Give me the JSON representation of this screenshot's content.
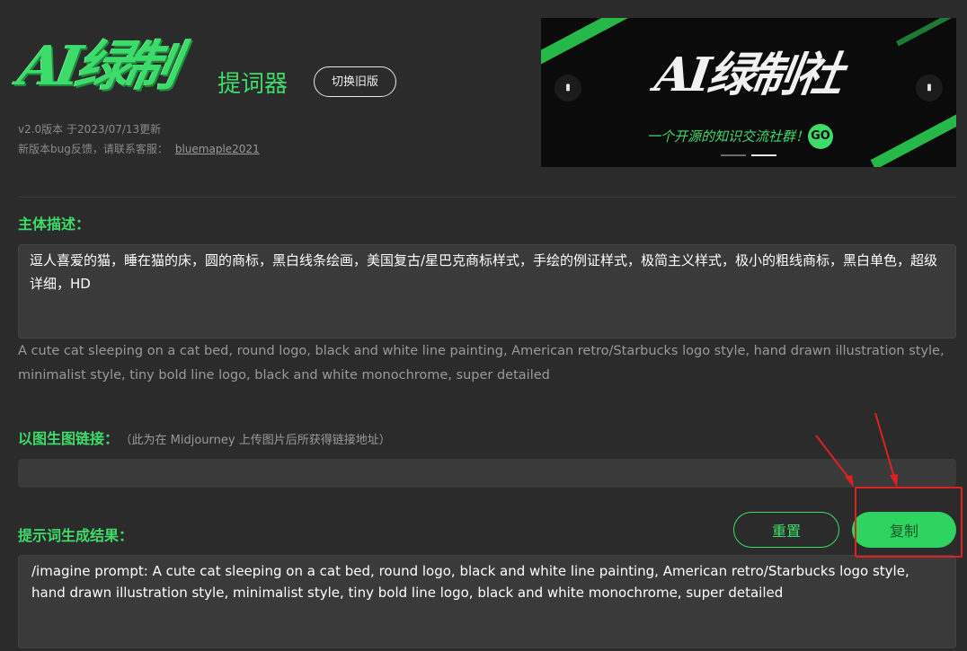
{
  "header": {
    "logo_text": "AI绿制",
    "logo_subtitle": "提词器",
    "switch_label": "切换旧版",
    "version": "v2.0版本 于2023/07/13更新",
    "feedback_text": "新版本bug反馈，请联系客服：",
    "feedback_contact": "bluemaple2021"
  },
  "banner": {
    "title": "AI绿制社",
    "slogan": "一个开源的知识交流社群！",
    "go": "GO",
    "prev_icon": "chevron-left-icon",
    "next_icon": "chevron-right-icon",
    "active_slide": 2,
    "slide_count": 2
  },
  "subject": {
    "title": "主体描述：",
    "text": "逗人喜爱的猫，睡在猫的床，圆的商标，黑白线条绘画，美国复古/星巴克商标样式，手绘的例证样式，极简主义样式，极小的粗线商标，黑白单色，超级详细，HD",
    "translation": "A cute cat sleeping on a cat bed, round logo, black and white line painting, American retro/Starbucks logo style, hand drawn illustration style, minimalist style, tiny bold line logo, black and white monochrome, super detailed"
  },
  "image_link": {
    "title": "以图生图链接：",
    "hint": "（此为在 Midjourney 上传图片后所获得链接地址）",
    "value": ""
  },
  "result": {
    "title": "提示词生成结果：",
    "reset_label": "重置",
    "copy_label": "复制",
    "text": "/imagine prompt:  A cute cat sleeping on a cat bed, round logo, black and white line painting, American retro/Starbucks logo style, hand drawn illustration style, minimalist style, tiny bold line logo, black and white monochrome, super detailed"
  },
  "colors": {
    "accent": "#3ddc6a",
    "background": "#2b2b2b",
    "input_bg": "#3a3a3a",
    "annotation": "#e02020"
  }
}
